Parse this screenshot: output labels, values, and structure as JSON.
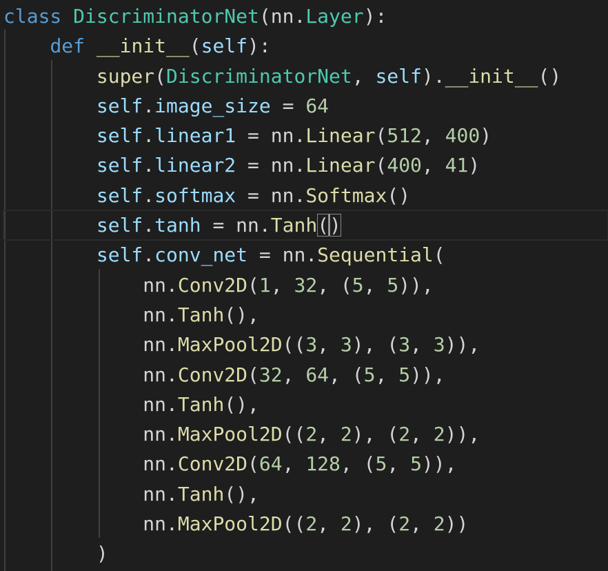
{
  "editor": {
    "theme_colors": {
      "background": "#1e1e1e",
      "keyword": "#569cd6",
      "class_name": "#4ec9b0",
      "function": "#dcdcaa",
      "variable": "#9cdcfe",
      "number": "#b5cea8",
      "default": "#d4d4d4"
    },
    "lines": [
      [
        {
          "t": "class",
          "k": "kw"
        },
        {
          "t": " ",
          "k": "punc"
        },
        {
          "t": "DiscriminatorNet",
          "k": "cls"
        },
        {
          "t": "(nn.",
          "k": "punc"
        },
        {
          "t": "Layer",
          "k": "cls"
        },
        {
          "t": "):",
          "k": "punc"
        }
      ],
      [
        {
          "t": "    ",
          "k": "punc"
        },
        {
          "t": "def",
          "k": "kw"
        },
        {
          "t": " ",
          "k": "punc"
        },
        {
          "t": "__init__",
          "k": "fn"
        },
        {
          "t": "(",
          "k": "punc"
        },
        {
          "t": "self",
          "k": "self"
        },
        {
          "t": "):",
          "k": "punc"
        }
      ],
      [
        {
          "t": "        ",
          "k": "punc"
        },
        {
          "t": "super",
          "k": "fn"
        },
        {
          "t": "(",
          "k": "punc"
        },
        {
          "t": "DiscriminatorNet",
          "k": "cls"
        },
        {
          "t": ", ",
          "k": "punc"
        },
        {
          "t": "self",
          "k": "self"
        },
        {
          "t": ").",
          "k": "punc"
        },
        {
          "t": "__init__",
          "k": "fn"
        },
        {
          "t": "()",
          "k": "punc"
        }
      ],
      [
        {
          "t": "        ",
          "k": "punc"
        },
        {
          "t": "self",
          "k": "self"
        },
        {
          "t": ".",
          "k": "punc"
        },
        {
          "t": "image_size",
          "k": "prop"
        },
        {
          "t": " = ",
          "k": "punc"
        },
        {
          "t": "64",
          "k": "num"
        }
      ],
      [
        {
          "t": "        ",
          "k": "punc"
        },
        {
          "t": "self",
          "k": "self"
        },
        {
          "t": ".",
          "k": "punc"
        },
        {
          "t": "linear1",
          "k": "prop"
        },
        {
          "t": " = nn.",
          "k": "punc"
        },
        {
          "t": "Linear",
          "k": "fn"
        },
        {
          "t": "(",
          "k": "punc"
        },
        {
          "t": "512",
          "k": "num"
        },
        {
          "t": ", ",
          "k": "punc"
        },
        {
          "t": "400",
          "k": "num"
        },
        {
          "t": ")",
          "k": "punc"
        }
      ],
      [
        {
          "t": "        ",
          "k": "punc"
        },
        {
          "t": "self",
          "k": "self"
        },
        {
          "t": ".",
          "k": "punc"
        },
        {
          "t": "linear2",
          "k": "prop"
        },
        {
          "t": " = nn.",
          "k": "punc"
        },
        {
          "t": "Linear",
          "k": "fn"
        },
        {
          "t": "(",
          "k": "punc"
        },
        {
          "t": "400",
          "k": "num"
        },
        {
          "t": ", ",
          "k": "punc"
        },
        {
          "t": "41",
          "k": "num"
        },
        {
          "t": ")",
          "k": "punc"
        }
      ],
      [
        {
          "t": "        ",
          "k": "punc"
        },
        {
          "t": "self",
          "k": "self"
        },
        {
          "t": ".",
          "k": "punc"
        },
        {
          "t": "softmax",
          "k": "prop"
        },
        {
          "t": " = nn.",
          "k": "punc"
        },
        {
          "t": "Softmax",
          "k": "fn"
        },
        {
          "t": "()",
          "k": "punc"
        }
      ],
      [
        {
          "t": "        ",
          "k": "punc"
        },
        {
          "t": "self",
          "k": "self"
        },
        {
          "t": ".",
          "k": "punc"
        },
        {
          "t": "tanh",
          "k": "prop"
        },
        {
          "t": " = nn.",
          "k": "punc"
        },
        {
          "t": "Tanh",
          "k": "fn"
        },
        {
          "t": "(",
          "k": "bracket"
        },
        {
          "t": ")",
          "k": "bracket"
        }
      ],
      [
        {
          "t": "        ",
          "k": "punc"
        },
        {
          "t": "self",
          "k": "self"
        },
        {
          "t": ".",
          "k": "punc"
        },
        {
          "t": "conv_net",
          "k": "prop"
        },
        {
          "t": " = nn.",
          "k": "punc"
        },
        {
          "t": "Sequential",
          "k": "fn"
        },
        {
          "t": "(",
          "k": "punc"
        }
      ],
      [
        {
          "t": "            nn.",
          "k": "punc"
        },
        {
          "t": "Conv2D",
          "k": "fn"
        },
        {
          "t": "(",
          "k": "punc"
        },
        {
          "t": "1",
          "k": "num"
        },
        {
          "t": ", ",
          "k": "punc"
        },
        {
          "t": "32",
          "k": "num"
        },
        {
          "t": ", (",
          "k": "punc"
        },
        {
          "t": "5",
          "k": "num"
        },
        {
          "t": ", ",
          "k": "punc"
        },
        {
          "t": "5",
          "k": "num"
        },
        {
          "t": ")),",
          "k": "punc"
        }
      ],
      [
        {
          "t": "            nn.",
          "k": "punc"
        },
        {
          "t": "Tanh",
          "k": "fn"
        },
        {
          "t": "(),",
          "k": "punc"
        }
      ],
      [
        {
          "t": "            nn.",
          "k": "punc"
        },
        {
          "t": "MaxPool2D",
          "k": "fn"
        },
        {
          "t": "((",
          "k": "punc"
        },
        {
          "t": "3",
          "k": "num"
        },
        {
          "t": ", ",
          "k": "punc"
        },
        {
          "t": "3",
          "k": "num"
        },
        {
          "t": "), (",
          "k": "punc"
        },
        {
          "t": "3",
          "k": "num"
        },
        {
          "t": ", ",
          "k": "punc"
        },
        {
          "t": "3",
          "k": "num"
        },
        {
          "t": ")),",
          "k": "punc"
        }
      ],
      [
        {
          "t": "            nn.",
          "k": "punc"
        },
        {
          "t": "Conv2D",
          "k": "fn"
        },
        {
          "t": "(",
          "k": "punc"
        },
        {
          "t": "32",
          "k": "num"
        },
        {
          "t": ", ",
          "k": "punc"
        },
        {
          "t": "64",
          "k": "num"
        },
        {
          "t": ", (",
          "k": "punc"
        },
        {
          "t": "5",
          "k": "num"
        },
        {
          "t": ", ",
          "k": "punc"
        },
        {
          "t": "5",
          "k": "num"
        },
        {
          "t": ")),",
          "k": "punc"
        }
      ],
      [
        {
          "t": "            nn.",
          "k": "punc"
        },
        {
          "t": "Tanh",
          "k": "fn"
        },
        {
          "t": "(),",
          "k": "punc"
        }
      ],
      [
        {
          "t": "            nn.",
          "k": "punc"
        },
        {
          "t": "MaxPool2D",
          "k": "fn"
        },
        {
          "t": "((",
          "k": "punc"
        },
        {
          "t": "2",
          "k": "num"
        },
        {
          "t": ", ",
          "k": "punc"
        },
        {
          "t": "2",
          "k": "num"
        },
        {
          "t": "), (",
          "k": "punc"
        },
        {
          "t": "2",
          "k": "num"
        },
        {
          "t": ", ",
          "k": "punc"
        },
        {
          "t": "2",
          "k": "num"
        },
        {
          "t": ")),",
          "k": "punc"
        }
      ],
      [
        {
          "t": "            nn.",
          "k": "punc"
        },
        {
          "t": "Conv2D",
          "k": "fn"
        },
        {
          "t": "(",
          "k": "punc"
        },
        {
          "t": "64",
          "k": "num"
        },
        {
          "t": ", ",
          "k": "punc"
        },
        {
          "t": "128",
          "k": "num"
        },
        {
          "t": ", (",
          "k": "punc"
        },
        {
          "t": "5",
          "k": "num"
        },
        {
          "t": ", ",
          "k": "punc"
        },
        {
          "t": "5",
          "k": "num"
        },
        {
          "t": ")),",
          "k": "punc"
        }
      ],
      [
        {
          "t": "            nn.",
          "k": "punc"
        },
        {
          "t": "Tanh",
          "k": "fn"
        },
        {
          "t": "(),",
          "k": "punc"
        }
      ],
      [
        {
          "t": "            nn.",
          "k": "punc"
        },
        {
          "t": "MaxPool2D",
          "k": "fn"
        },
        {
          "t": "((",
          "k": "punc"
        },
        {
          "t": "2",
          "k": "num"
        },
        {
          "t": ", ",
          "k": "punc"
        },
        {
          "t": "2",
          "k": "num"
        },
        {
          "t": "), (",
          "k": "punc"
        },
        {
          "t": "2",
          "k": "num"
        },
        {
          "t": ", ",
          "k": "punc"
        },
        {
          "t": "2",
          "k": "num"
        },
        {
          "t": "))",
          "k": "punc"
        }
      ],
      [
        {
          "t": "        )",
          "k": "punc"
        }
      ]
    ]
  }
}
